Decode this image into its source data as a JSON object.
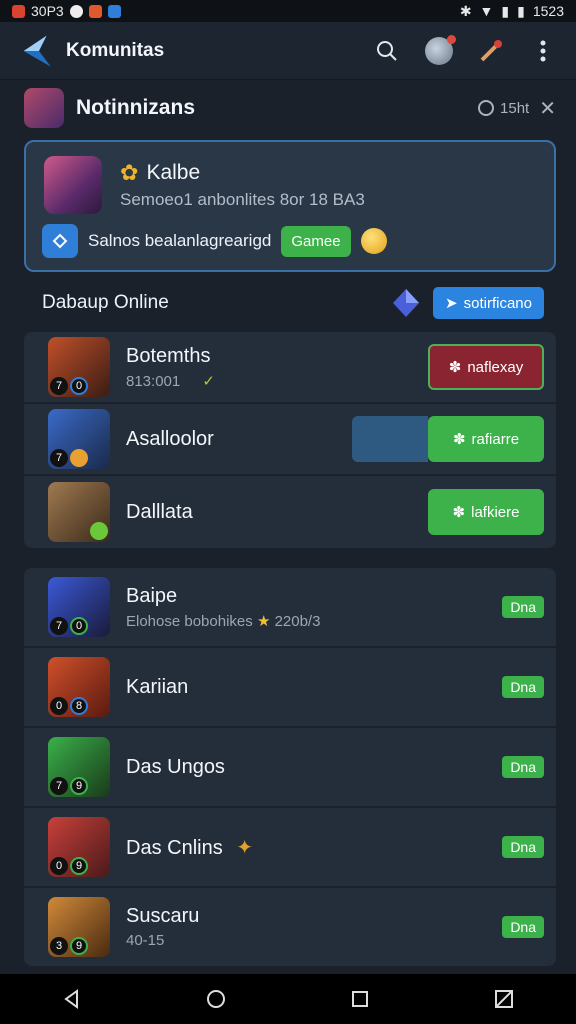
{
  "status_bar": {
    "left_text": "30P3",
    "right_text": "1523"
  },
  "app_bar": {
    "title": "Komunitas"
  },
  "notification": {
    "title": "Notinnizans",
    "time": "15ht"
  },
  "featured": {
    "name": "Kalbe",
    "subtitle": "Semoeo1 anbonlites  8or 18 BA3",
    "action_text": "Salnos bealanlagrearigd",
    "action_button": "Gamee"
  },
  "online_section": {
    "label": "Dabaup Online",
    "button_label": "sotirficano"
  },
  "online_list": [
    {
      "name": "Botemths",
      "subtitle": "813:001",
      "lvl1": "7",
      "lvl2": "0",
      "button": "naflexay",
      "button_style": "red"
    },
    {
      "name": "Asalloolor",
      "subtitle": "",
      "lvl1": "7",
      "lvl2": "",
      "button": "rafiarre",
      "button_style": "green"
    },
    {
      "name": "Dalllata",
      "subtitle": "",
      "lvl1": "",
      "lvl2": "",
      "button": "lafkiere",
      "button_style": "green"
    }
  ],
  "other_list": [
    {
      "name": "Baipe",
      "subtitle": "Elohose bobohikes",
      "extra": "220b/3",
      "lvl1": "7",
      "lvl2": "0",
      "tag": "Dna"
    },
    {
      "name": "Kariian",
      "subtitle": "",
      "extra": "",
      "lvl1": "0",
      "lvl2": "8",
      "tag": "Dna"
    },
    {
      "name": "Das Ungos",
      "subtitle": "",
      "extra": "",
      "lvl1": "7",
      "lvl2": "9",
      "tag": "Dna"
    },
    {
      "name": "Das Cnlins",
      "subtitle": "",
      "extra": "",
      "lvl1": "0",
      "lvl2": "9",
      "tag": "Dna"
    },
    {
      "name": "Suscaru",
      "subtitle": "40-15",
      "extra": "",
      "lvl1": "3",
      "lvl2": "9",
      "tag": "Dna"
    }
  ],
  "colors": {
    "accent_blue": "#2a84e0",
    "accent_green": "#3db24a",
    "danger_red": "#8a2430"
  }
}
